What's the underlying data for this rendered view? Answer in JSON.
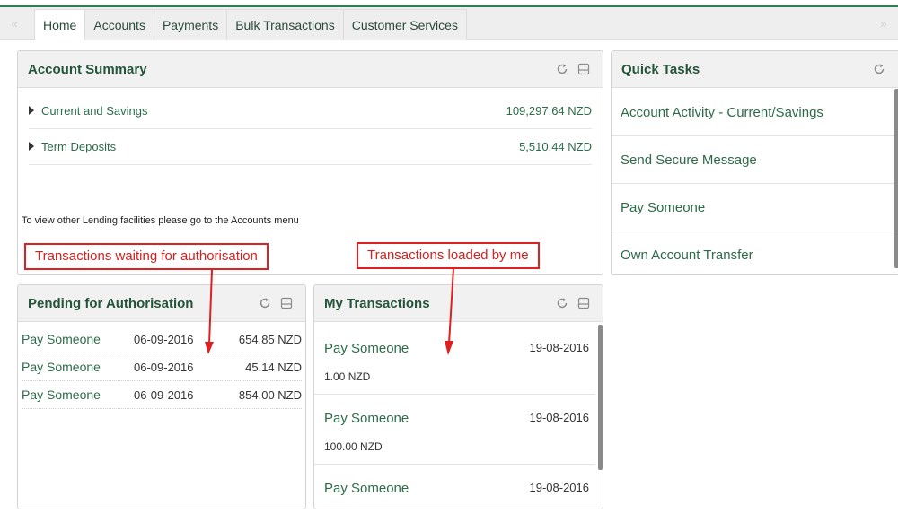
{
  "nav": {
    "tabs": [
      "Home",
      "Accounts",
      "Payments",
      "Bulk Transactions",
      "Customer Services"
    ],
    "active_tab": "Home",
    "prev_arrow": "«",
    "next_arrow": "»"
  },
  "account_summary": {
    "title": "Account Summary",
    "rows": [
      {
        "label": "Current and Savings",
        "amount": "109,297.64 NZD"
      },
      {
        "label": "Term Deposits",
        "amount": "5,510.44 NZD"
      }
    ],
    "note": "To view other Lending facilities please go to the Accounts menu"
  },
  "quick_tasks": {
    "title": "Quick Tasks",
    "items": [
      "Account Activity - Current/Savings",
      "Send Secure Message",
      "Pay Someone",
      "Own Account Transfer"
    ]
  },
  "pending": {
    "title": "Pending for Authorisation",
    "rows": [
      {
        "payee": "Pay Someone",
        "date": "06-09-2016",
        "amount": "654.85 NZD"
      },
      {
        "payee": "Pay Someone",
        "date": "06-09-2016",
        "amount": "45.14 NZD"
      },
      {
        "payee": "Pay Someone",
        "date": "06-09-2016",
        "amount": "854.00 NZD"
      }
    ]
  },
  "my_transactions": {
    "title": "My Transactions",
    "items": [
      {
        "payee": "Pay Someone",
        "date": "19-08-2016",
        "amount": "1.00 NZD"
      },
      {
        "payee": "Pay Someone",
        "date": "19-08-2016",
        "amount": "100.00 NZD"
      },
      {
        "payee": "Pay Someone",
        "date": "19-08-2016",
        "amount": ""
      }
    ]
  },
  "annotations": {
    "left_callout": "Transactions waiting for authorisation",
    "right_callout": "Transactions loaded by me"
  },
  "colors": {
    "brand_green": "#2e7d52",
    "title_green": "#24543a",
    "link_green": "#2c6b48",
    "annotation_red": "#e02020"
  },
  "icons": {
    "refresh": "refresh-icon",
    "minimize": "minimize-icon"
  }
}
